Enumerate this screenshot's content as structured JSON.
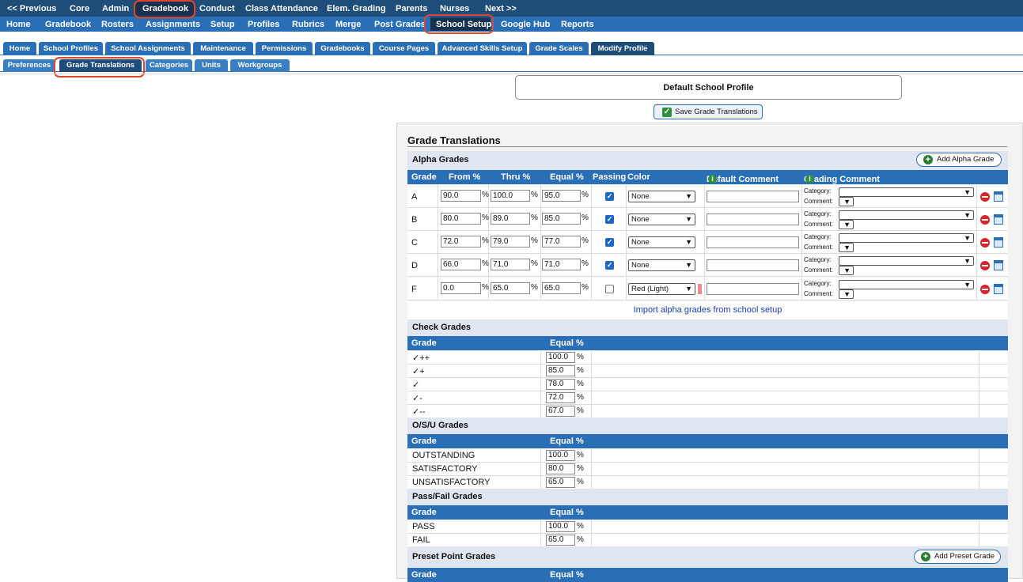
{
  "nav_top": [
    "<< Previous",
    "Core",
    "Admin",
    "Gradebook",
    "Conduct",
    "Class Attendance",
    "Elem. Grading",
    "Parents",
    "Nurses",
    "Next >>"
  ],
  "nav_sub": [
    "Home",
    "Gradebook",
    "Rosters",
    "Assignments",
    "Setup",
    "Profiles",
    "Rubrics",
    "Merge",
    "Post Grades",
    "School Setup",
    "Google Hub",
    "Reports"
  ],
  "tabs": [
    "Home",
    "School Profiles",
    "School Assignments",
    "Maintenance",
    "Permissions",
    "Gradebooks",
    "Course Pages",
    "Advanced Skills Setup",
    "Grade Scales",
    "Modify Profile"
  ],
  "subtabs": [
    "Preferences",
    "Grade Translations",
    "Categories",
    "Units",
    "Workgroups"
  ],
  "profile_title": "Default School Profile",
  "save_button": "Save Grade Translations",
  "panel_title": "Grade Translations",
  "alpha": {
    "title": "Alpha Grades",
    "add_button": "Add Alpha Grade",
    "headers": [
      "Grade",
      "From %",
      "Thru %",
      "Equal %",
      "Passing",
      "Color",
      "Default Comment",
      "Grading Comment"
    ],
    "rows": [
      {
        "grade": "A",
        "from": "90.0",
        "thru": "100.0",
        "equal": "95.0",
        "passing": true,
        "color": "None"
      },
      {
        "grade": "B",
        "from": "80.0",
        "thru": "89.0",
        "equal": "85.0",
        "passing": true,
        "color": "None"
      },
      {
        "grade": "C",
        "from": "72.0",
        "thru": "79.0",
        "equal": "77.0",
        "passing": true,
        "color": "None"
      },
      {
        "grade": "D",
        "from": "66.0",
        "thru": "71.0",
        "equal": "71.0",
        "passing": true,
        "color": "None"
      },
      {
        "grade": "F",
        "from": "0.0",
        "thru": "65.0",
        "equal": "65.0",
        "passing": false,
        "color": "Red (Light)"
      }
    ],
    "category_label": "Category:",
    "comment_label": "Comment:",
    "percent_sign": "%",
    "import_link": "Import alpha grades from school setup"
  },
  "check": {
    "title": "Check Grades",
    "headers": [
      "Grade",
      "Equal %"
    ],
    "rows": [
      {
        "grade": "✓++",
        "equal": "100.0"
      },
      {
        "grade": "✓+",
        "equal": "85.0"
      },
      {
        "grade": "✓",
        "equal": "78.0"
      },
      {
        "grade": "✓-",
        "equal": "72.0"
      },
      {
        "grade": "✓--",
        "equal": "67.0"
      }
    ]
  },
  "osu": {
    "title": "O/S/U Grades",
    "headers": [
      "Grade",
      "Equal %"
    ],
    "rows": [
      {
        "grade": "OUTSTANDING",
        "equal": "100.0"
      },
      {
        "grade": "SATISFACTORY",
        "equal": "80.0"
      },
      {
        "grade": "UNSATISFACTORY",
        "equal": "65.0"
      }
    ]
  },
  "passfail": {
    "title": "Pass/Fail Grades",
    "headers": [
      "Grade",
      "Equal %"
    ],
    "rows": [
      {
        "grade": "PASS",
        "equal": "100.0"
      },
      {
        "grade": "FAIL",
        "equal": "65.0"
      }
    ]
  },
  "preset": {
    "title": "Preset Point Grades",
    "add_button": "Add Preset Grade",
    "headers": [
      "Grade",
      "Equal %"
    ]
  },
  "colors": {
    "nav_dark": "#1f4d7a",
    "nav_blue": "#2a6fb5",
    "highlight": "#e0452e",
    "section_bg": "#dfe6ef",
    "link": "#1a3fb0"
  }
}
